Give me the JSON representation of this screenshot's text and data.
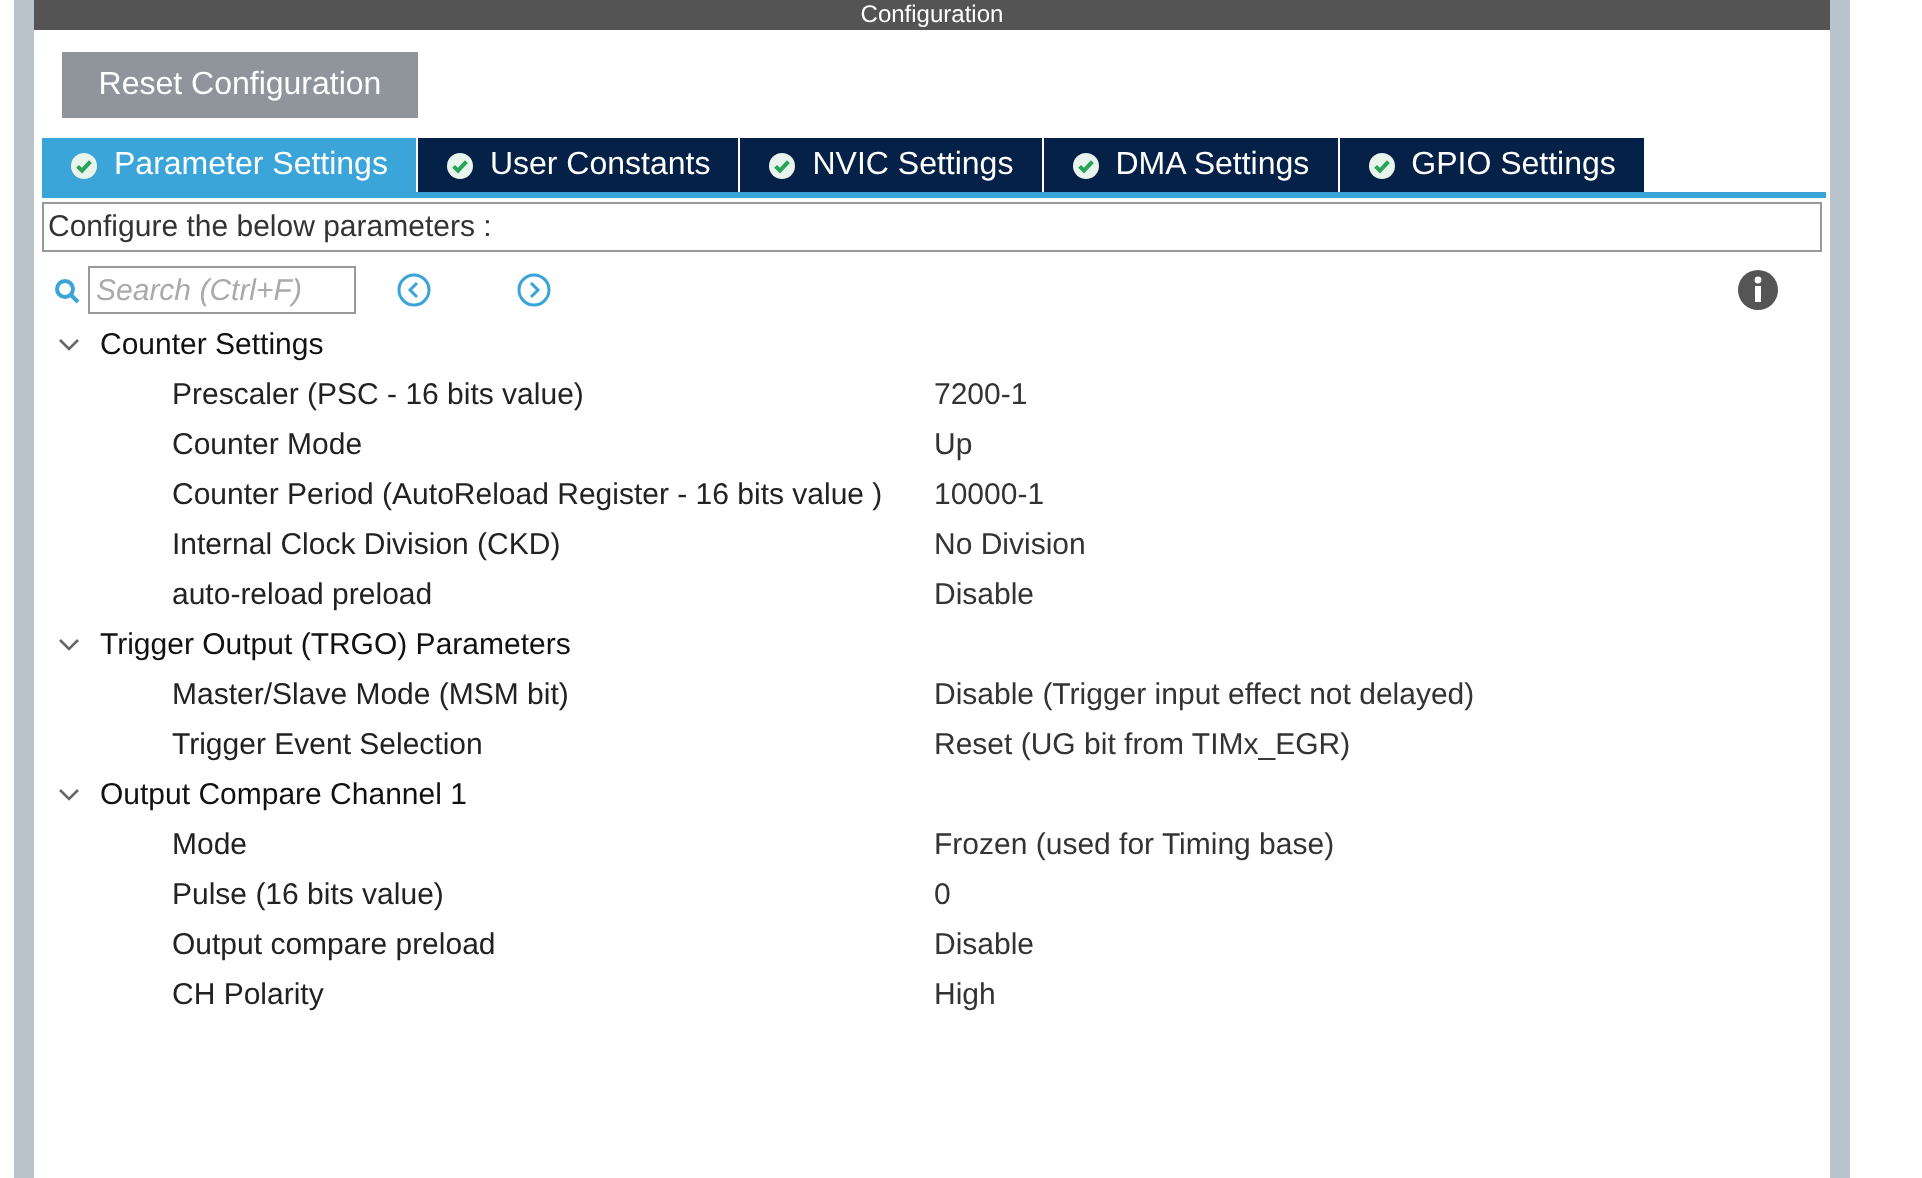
{
  "window": {
    "title": "Configuration"
  },
  "reset_button": "Reset Configuration",
  "tabs": [
    {
      "label": "Parameter Settings",
      "selected": true
    },
    {
      "label": "User Constants",
      "selected": false
    },
    {
      "label": "NVIC Settings",
      "selected": false
    },
    {
      "label": "DMA Settings",
      "selected": false
    },
    {
      "label": "GPIO Settings",
      "selected": false
    }
  ],
  "description": "Configure the below parameters :",
  "search": {
    "placeholder": "Search (Ctrl+F)"
  },
  "groups": [
    {
      "title": "Counter Settings",
      "expanded": true,
      "params": [
        {
          "name": "Prescaler (PSC - 16 bits value)",
          "value": "7200-1"
        },
        {
          "name": "Counter Mode",
          "value": "Up"
        },
        {
          "name": "Counter Period (AutoReload Register - 16 bits value )",
          "value": "10000-1"
        },
        {
          "name": "Internal Clock Division (CKD)",
          "value": "No Division"
        },
        {
          "name": "auto-reload preload",
          "value": "Disable"
        }
      ]
    },
    {
      "title": "Trigger Output (TRGO) Parameters",
      "expanded": true,
      "params": [
        {
          "name": "Master/Slave Mode (MSM bit)",
          "value": "Disable (Trigger input effect not delayed)"
        },
        {
          "name": "Trigger Event Selection",
          "value": "Reset (UG bit from TIMx_EGR)"
        }
      ]
    },
    {
      "title": "Output Compare Channel 1",
      "expanded": true,
      "params": [
        {
          "name": "Mode",
          "value": "Frozen (used for Timing base)"
        },
        {
          "name": "Pulse (16 bits value)",
          "value": "0"
        },
        {
          "name": "Output compare preload",
          "value": "Disable"
        },
        {
          "name": "CH Polarity",
          "value": "High"
        }
      ]
    }
  ]
}
